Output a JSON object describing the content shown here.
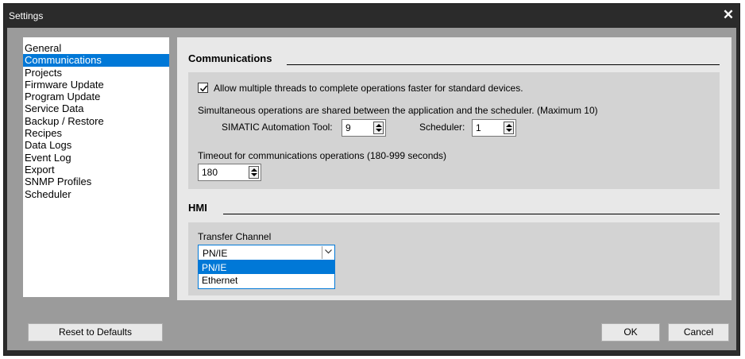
{
  "window": {
    "title": "Settings",
    "close_label": "✕"
  },
  "sidebar": {
    "items": [
      {
        "label": "General"
      },
      {
        "label": "Communications",
        "active": true
      },
      {
        "label": "Projects"
      },
      {
        "label": "Firmware Update"
      },
      {
        "label": "Program Update"
      },
      {
        "label": "Service Data"
      },
      {
        "label": "Backup / Restore"
      },
      {
        "label": "Recipes"
      },
      {
        "label": "Data Logs"
      },
      {
        "label": "Event Log"
      },
      {
        "label": "Export"
      },
      {
        "label": "SNMP Profiles"
      },
      {
        "label": "Scheduler"
      }
    ]
  },
  "communications": {
    "title": "Communications",
    "multithread_checked": true,
    "multithread_label": "Allow multiple threads to complete operations faster for standard devices.",
    "shared_text": "Simultaneous operations are shared between the application and the scheduler. (Maximum 10)",
    "sat_label": "SIMATIC Automation Tool:",
    "sat_value": "9",
    "scheduler_label": "Scheduler:",
    "scheduler_value": "1",
    "timeout_label": "Timeout for communications operations (180-999 seconds)",
    "timeout_value": "180"
  },
  "hmi": {
    "title": "HMI",
    "transfer_label": "Transfer Channel",
    "selected": "PN/IE",
    "options": [
      "PN/IE",
      "Ethernet"
    ]
  },
  "footer": {
    "reset_label": "Reset to Defaults",
    "ok_label": "OK",
    "cancel_label": "Cancel"
  },
  "colors": {
    "selection": "#0078d7",
    "titlebar": "#2b2b2b",
    "client": "#9b9b9b",
    "panel": "#e8e8e8",
    "group": "#d3d3d3"
  }
}
